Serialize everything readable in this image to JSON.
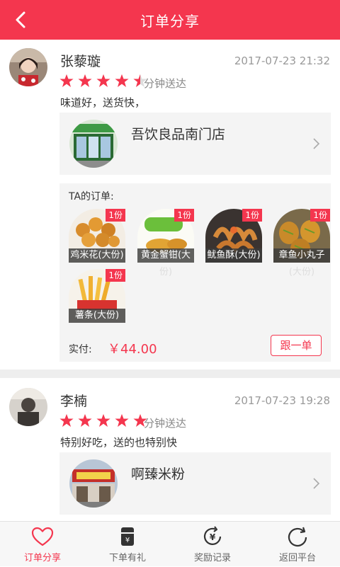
{
  "header": {
    "title": "订单分享"
  },
  "posts": [
    {
      "user": "张藜璇",
      "time": "2017-07-23 21:32",
      "rating": 4.5,
      "delivery": "分钟送达",
      "comment": "味道好，送货快，",
      "shop": {
        "name": "吾饮良品南门店"
      },
      "order_label": "TA的订单:",
      "items": [
        {
          "name": "鸡米花(大份)",
          "qty": "1份"
        },
        {
          "name": "黄金蟹钳(大",
          "overflow": "份)",
          "qty": "1份"
        },
        {
          "name": "鱿鱼酥(大份)",
          "qty": "1份"
        },
        {
          "name": "章鱼小丸子",
          "overflow": "(大份)",
          "qty": "1份"
        },
        {
          "name": "薯条(大份)",
          "qty": "1份"
        }
      ],
      "paid_label": "实付:",
      "price": "￥44.00",
      "follow_label": "跟一单"
    },
    {
      "user": "李楠",
      "time": "2017-07-23 19:28",
      "rating": 5,
      "delivery": "分钟送达",
      "comment": "特别好吃，送的也特别快",
      "shop": {
        "name": "啊臻米粉"
      }
    }
  ],
  "tabs": [
    {
      "label": "订单分享",
      "icon": "heart-icon",
      "active": true
    },
    {
      "label": "下单有礼",
      "icon": "gift-card-icon",
      "active": false
    },
    {
      "label": "奖励记录",
      "icon": "yen-refresh-icon",
      "active": false
    },
    {
      "label": "返回平台",
      "icon": "return-icon",
      "active": false
    }
  ],
  "colors": {
    "accent": "#f4364e",
    "star": "#f4364e"
  }
}
